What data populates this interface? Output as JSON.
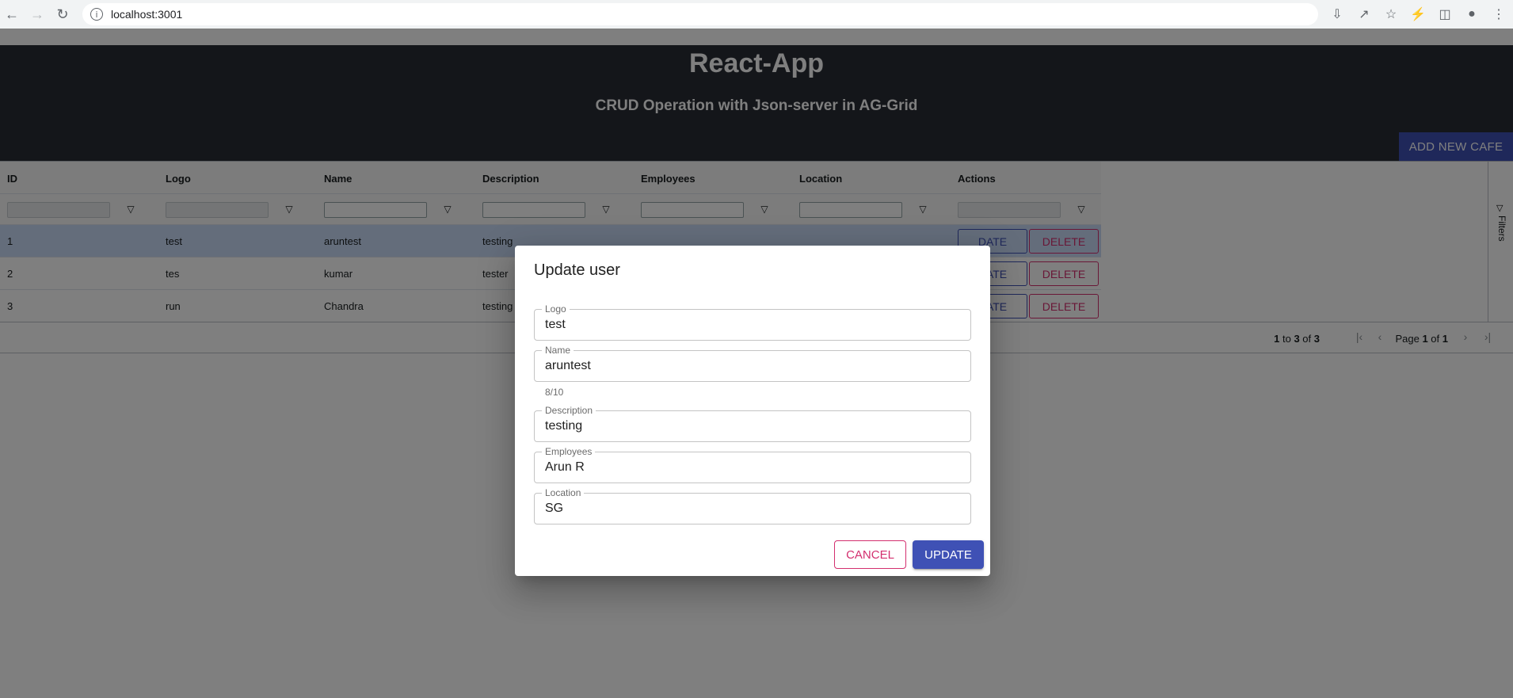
{
  "browser": {
    "url": "localhost:3001",
    "info_glyph": "i"
  },
  "app": {
    "title": "React-App",
    "subtitle": "CRUD Operation with Json-server in AG-Grid",
    "add_button": "ADD NEW CAFE"
  },
  "grid": {
    "columns": [
      "ID",
      "Logo",
      "Name",
      "Description",
      "Employees",
      "Location",
      "Actions"
    ],
    "rows": [
      {
        "id": "1",
        "logo": "test",
        "name": "aruntest",
        "description": "testing"
      },
      {
        "id": "2",
        "logo": "tes",
        "name": "kumar",
        "description": "tester"
      },
      {
        "id": "3",
        "logo": "run",
        "name": "Chandra",
        "description": "testing"
      }
    ],
    "update_label": "UPDATE",
    "delete_label": "DELETE",
    "update_label_visible": "DATE",
    "sidebar_label": "Filters",
    "pager": {
      "from": "1",
      "to_word": "to",
      "to": "3",
      "of_word": "of",
      "total": "3",
      "page_word": "Page",
      "page": "1",
      "page_of": "of",
      "pages": "1"
    }
  },
  "dialog": {
    "title": "Update user",
    "fields": [
      {
        "label": "Logo",
        "value": "test"
      },
      {
        "label": "Name",
        "value": "aruntest"
      },
      {
        "label": "Description",
        "value": "testing"
      },
      {
        "label": "Employees",
        "value": "Arun R"
      },
      {
        "label": "Location",
        "value": "SG"
      }
    ],
    "name_helper": "8/10",
    "cancel_label": "CANCEL",
    "update_label": "UPDATE"
  },
  "colors": {
    "header_bg": "#282c34",
    "primary": "#3f51b5",
    "danger": "#d32f6f",
    "selected_row": "#c8daf7"
  }
}
